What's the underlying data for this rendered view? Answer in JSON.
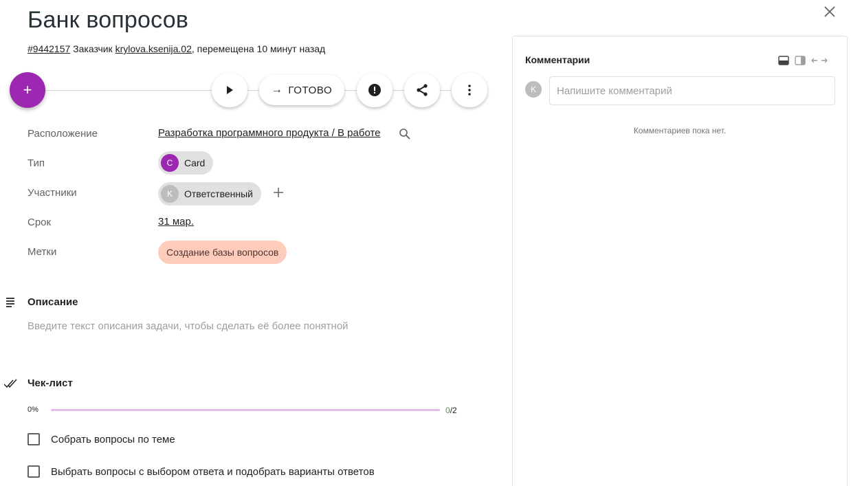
{
  "card": {
    "title": "Банк вопросов",
    "id_link": "#9442157",
    "customer_prefix": " Заказчик ",
    "customer_link": "krylova.ksenija.02",
    "moved_text": ", перемещена 10 минут назад"
  },
  "actions": {
    "add_symbol": "+",
    "done_arrow": "→",
    "done_label": "ГОТОВО"
  },
  "properties": {
    "location_label": "Расположение",
    "location_value": "Разработка программного продукта / В работе",
    "type_label": "Тип",
    "type_avatar": "C",
    "type_value": "Card",
    "participants_label": "Участники",
    "participant_avatar": "K",
    "participant_value": "Ответственный",
    "due_label": "Срок",
    "due_value": "31 мар.",
    "tags_label": "Метки",
    "tag_value": "Создание базы вопросов"
  },
  "description": {
    "title": "Описание",
    "placeholder": "Введите текст описания задачи, чтобы сделать её более понятной"
  },
  "checklist": {
    "title": "Чек-лист",
    "percent_label": "0%",
    "progress": 0,
    "done_count": "0",
    "total_count": "/2",
    "items": [
      {
        "label": "Собрать вопросы по теме",
        "checked": false
      },
      {
        "label": "Выбрать вопросы с выбором ответа и подобрать варианты ответов",
        "checked": false
      }
    ]
  },
  "comments": {
    "title": "Комментарии",
    "avatar": "K",
    "input_placeholder": "Напишите комментарий",
    "empty_text": "Комментариев пока нет."
  },
  "colors": {
    "accent": "#9c27b0",
    "tag_bg": "#ffccbc",
    "progress_track": "#e1bee7",
    "done_count": "#43a047"
  },
  "icons": {
    "close": "close-icon",
    "play": "play-icon",
    "alert": "alert-icon",
    "share": "share-icon",
    "more": "more-vertical-icon",
    "search": "search-icon",
    "add": "plus-icon",
    "description": "notes-icon",
    "checklist": "double-check-icon"
  }
}
